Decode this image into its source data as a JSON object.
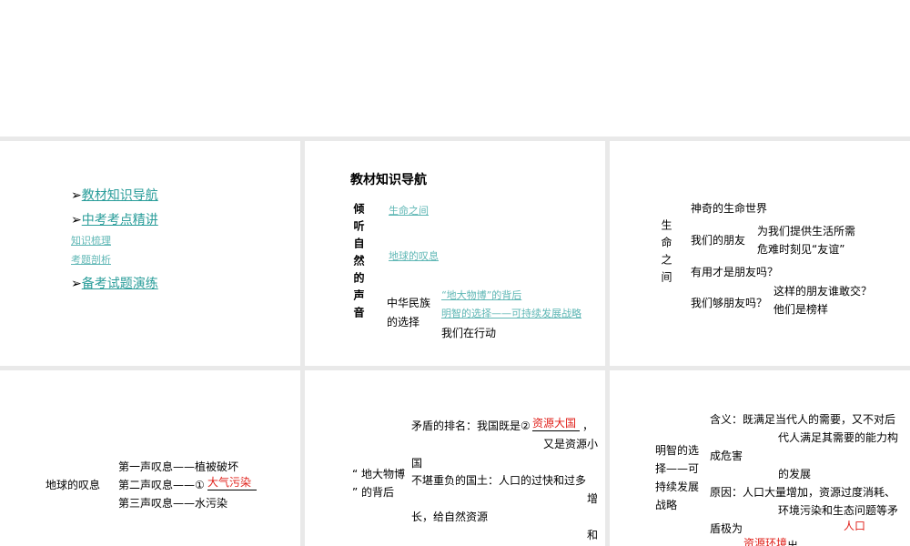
{
  "slide1": {
    "arrow": "➢",
    "items": [
      "教材知识导航",
      "中考考点精讲",
      "知识梳理",
      "考题剖析",
      "备考试题演练"
    ]
  },
  "slide2": {
    "title": "教材知识导航",
    "vertical": "倾听自然的声音",
    "links": [
      "生命之间",
      "地球的叹息",
      "“地大物博”的背后",
      "明智的选择——可持续发展战略"
    ],
    "group": "中华民族的选择",
    "group_l1": "中华民族",
    "group_l2": "的选择",
    "plain": "我们在行动"
  },
  "slide3": {
    "vertical": "生命之间",
    "items": [
      "神奇的生命世界",
      "我们的朋友",
      "为我们提供生活所需",
      "危难时刻见“友谊”",
      "有用才是朋友吗？",
      "我们够朋友吗？",
      "这样的朋友谁敢交？",
      "他们是榜样"
    ]
  },
  "slide4": {
    "label": "地球的叹息",
    "lines": [
      "第一声叹息——植被破坏",
      "第二声叹息——①",
      "第三声叹息——水污染"
    ],
    "answer": "大气污染"
  },
  "slide5": {
    "label1": "“ 地大物博",
    "label2": "” 的背后",
    "l1": "矛盾的排名：我国既是②",
    "answer": "资源大国",
    "comma": "，",
    "l2": "又是资源小",
    "l3": "国",
    "l4": "不堪重负的国土：人口的过快和过多",
    "l5": "增",
    "l6": "长，给自然资源",
    "l7": "和"
  },
  "slide6": {
    "label": [
      "明智的选",
      "择——可",
      "持续发展",
      "战略"
    ],
    "l1": "含义：既满足当代人的需要，又不对后",
    "l2": "代人满足其需要的能力构",
    "l3": "成危害",
    "l4": "的发展",
    "l5": "原因：人口大量增加，资源过度消耗、",
    "l6": "环境污染和生态问题等矛",
    "l7": "盾极为",
    "a1": "人口",
    "a2": "资源环境",
    "l8": "出"
  }
}
